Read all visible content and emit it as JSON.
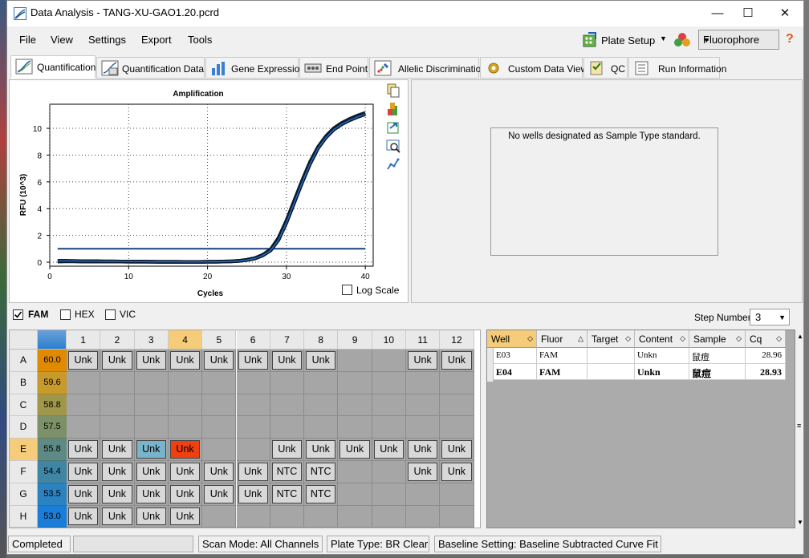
{
  "window": {
    "title": "Data Analysis - TANG-XU-GAO1.20.pcrd",
    "minimize": "—",
    "maximize": "☐",
    "close": "✕"
  },
  "menu": [
    "File",
    "View",
    "Settings",
    "Export",
    "Tools"
  ],
  "toolbar": {
    "plate_setup": "Plate Setup",
    "fluorophore": "Fluorophore"
  },
  "tabs": [
    "Quantification",
    "Quantification Data",
    "Gene Expression",
    "End Point",
    "Allelic Discrimination",
    "Custom Data View",
    "QC",
    "Run Information"
  ],
  "chart_data": {
    "type": "line",
    "title": "Amplification",
    "xlabel": "Cycles",
    "ylabel": "RFU (10^3)",
    "xlim": [
      0,
      41
    ],
    "ylim": [
      -0.3,
      11.8
    ],
    "x_ticks": [
      "0",
      "10",
      "20",
      "30",
      "40"
    ],
    "y_ticks": [
      "0",
      "2",
      "4",
      "6",
      "8",
      "10"
    ],
    "threshold": 1.0,
    "grid": true,
    "series": [
      {
        "x": [
          1,
          2,
          3,
          4,
          5,
          6,
          7,
          8,
          9,
          10,
          11,
          12,
          13,
          14,
          15,
          16,
          17,
          18,
          19,
          20,
          21,
          22,
          23,
          24,
          25,
          26,
          27,
          28,
          29,
          30,
          31,
          32,
          33,
          34,
          35,
          36,
          37,
          38,
          39,
          40
        ],
        "y": [
          0.05,
          0.06,
          0.06,
          0.05,
          0.05,
          0.05,
          0.04,
          0.04,
          0.04,
          0.03,
          0.03,
          0.03,
          0.03,
          0.02,
          0.02,
          0.02,
          0.02,
          0.02,
          0.02,
          0.03,
          0.03,
          0.04,
          0.06,
          0.1,
          0.18,
          0.3,
          0.55,
          0.95,
          1.8,
          3.1,
          4.6,
          6.1,
          7.5,
          8.6,
          9.4,
          10.0,
          10.4,
          10.7,
          10.95,
          11.15
        ]
      },
      {
        "x": [
          1,
          2,
          3,
          4,
          5,
          6,
          7,
          8,
          9,
          10,
          11,
          12,
          13,
          14,
          15,
          16,
          17,
          18,
          19,
          20,
          21,
          22,
          23,
          24,
          25,
          26,
          27,
          28,
          29,
          30,
          31,
          32,
          33,
          34,
          35,
          36,
          37,
          38,
          39,
          40
        ],
        "y": [
          0.1,
          0.1,
          0.09,
          0.08,
          0.08,
          0.07,
          0.06,
          0.06,
          0.05,
          0.05,
          0.04,
          0.04,
          0.03,
          0.03,
          0.03,
          0.03,
          0.02,
          0.02,
          0.02,
          0.03,
          0.03,
          0.04,
          0.06,
          0.09,
          0.16,
          0.27,
          0.5,
          0.88,
          1.65,
          2.95,
          4.45,
          5.95,
          7.35,
          8.5,
          9.3,
          9.9,
          10.3,
          10.6,
          10.85,
          11.05
        ]
      }
    ]
  },
  "log_scale_label": "Log Scale",
  "std_curve_message": "No wells designated as Sample Type standard.",
  "fluor_checks": [
    {
      "label": "FAM",
      "checked": true
    },
    {
      "label": "HEX",
      "checked": false
    },
    {
      "label": "VIC",
      "checked": false
    }
  ],
  "step_number": {
    "label": "Step Number:",
    "value": "3"
  },
  "plate": {
    "columns": [
      "1",
      "2",
      "3",
      "4",
      "5",
      "6",
      "7",
      "8",
      "9",
      "10",
      "11",
      "12"
    ],
    "rows": [
      {
        "label": "A",
        "cq_color": "60.0",
        "color": "#e08a00",
        "wells": [
          "Unk",
          "Unk",
          "Unk",
          "Unk",
          "Unk",
          "Unk",
          "Unk",
          "Unk",
          "",
          "",
          "Unk",
          "Unk"
        ]
      },
      {
        "label": "B",
        "cq_color": "59.6",
        "color": "#c89a2a",
        "wells": [
          "",
          "",
          "",
          "",
          "",
          "",
          "",
          "",
          "",
          "",
          "",
          ""
        ]
      },
      {
        "label": "C",
        "cq_color": "58.8",
        "color": "#a0974a",
        "wells": [
          "",
          "",
          "",
          "",
          "",
          "",
          "",
          "",
          "",
          "",
          "",
          ""
        ]
      },
      {
        "label": "D",
        "cq_color": "57.5",
        "color": "#7d9168",
        "wells": [
          "",
          "",
          "",
          "",
          "",
          "",
          "",
          "",
          "",
          "",
          "",
          ""
        ]
      },
      {
        "label": "E",
        "cq_color": "55.8",
        "color": "#5d8a85",
        "wells": [
          "Unk",
          "Unk",
          "Unk",
          "Unk",
          "",
          "",
          "Unk",
          "Unk",
          "Unk",
          "Unk",
          "Unk",
          "Unk"
        ]
      },
      {
        "label": "F",
        "cq_color": "54.4",
        "color": "#3f86a5",
        "wells": [
          "Unk",
          "Unk",
          "Unk",
          "Unk",
          "Unk",
          "Unk",
          "NTC",
          "NTC",
          "",
          "",
          "Unk",
          "Unk"
        ]
      },
      {
        "label": "G",
        "cq_color": "53.5",
        "color": "#2a82c0",
        "wells": [
          "Unk",
          "Unk",
          "Unk",
          "Unk",
          "Unk",
          "Unk",
          "NTC",
          "NTC",
          "",
          "",
          "",
          ""
        ]
      },
      {
        "label": "H",
        "cq_color": "53.0",
        "color": "#1a7ed8",
        "wells": [
          "Unk",
          "Unk",
          "Unk",
          "Unk",
          "",
          "",
          "",
          "",
          "",
          "",
          "",
          ""
        ]
      }
    ],
    "selected_row": "E",
    "highlight_wells": [
      {
        "row": "E",
        "col": "3",
        "color": "#78b4cc"
      },
      {
        "row": "E",
        "col": "4",
        "color": "#f04010"
      }
    ]
  },
  "table": {
    "headers": [
      "Well",
      "Fluor",
      "Target",
      "Content",
      "Sample",
      "Cq"
    ],
    "rows": [
      {
        "well": "E03",
        "fluor": "FAM",
        "target": "",
        "content": "Unkn",
        "sample": "鼠痘",
        "cq": "28.96",
        "bold": false
      },
      {
        "well": "E04",
        "fluor": "FAM",
        "target": "",
        "content": "Unkn",
        "sample": "鼠痘",
        "cq": "28.93",
        "bold": true
      }
    ]
  },
  "status": {
    "state": "Completed",
    "scan_mode": "Scan Mode: All Channels",
    "plate_type": "Plate Type: BR Clear",
    "baseline": "Baseline Setting: Baseline Subtracted Curve Fit"
  }
}
